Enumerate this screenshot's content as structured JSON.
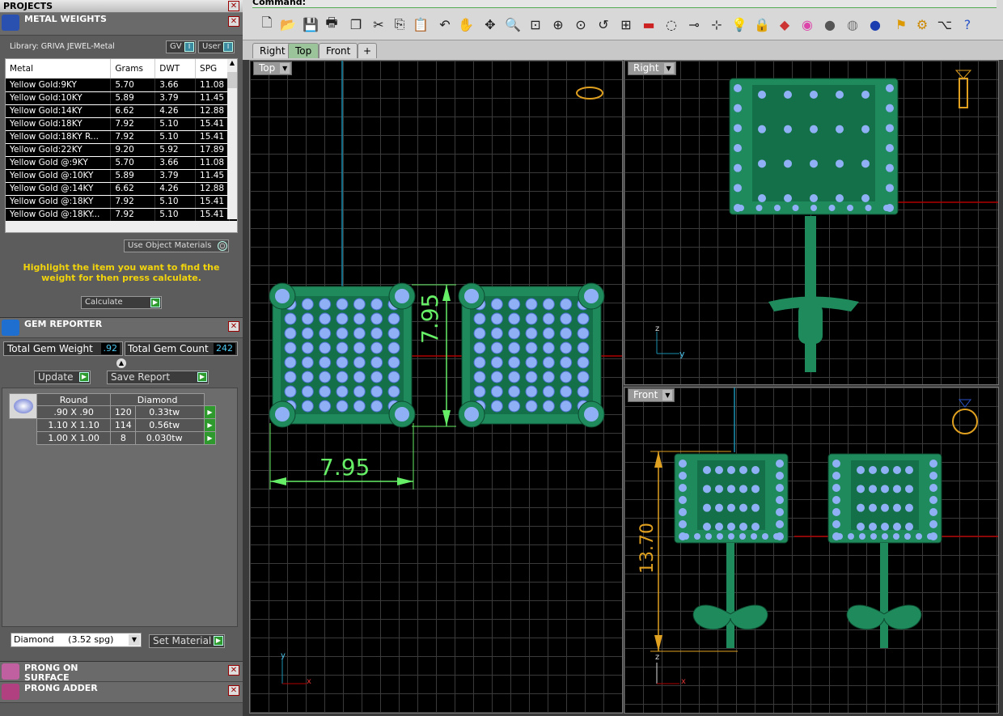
{
  "command_label": "Command:",
  "panels": {
    "projects": {
      "title": "PROJECTS"
    },
    "metal_weights": {
      "title": "METAL WEIGHTS",
      "library": "Library: GRIVA JEWEL-Metal",
      "gv": "GV",
      "user": "User",
      "columns": [
        "Metal",
        "Grams",
        "DWT",
        "SPG"
      ],
      "rows": [
        [
          "Yellow Gold:9KY",
          "5.70",
          "3.66",
          "11.08"
        ],
        [
          "Yellow Gold:10KY",
          "5.89",
          "3.79",
          "11.45"
        ],
        [
          "Yellow Gold:14KY",
          "6.62",
          "4.26",
          "12.88"
        ],
        [
          "Yellow Gold:18KY",
          "7.92",
          "5.10",
          "15.41"
        ],
        [
          "Yellow Gold:18KY R...",
          "7.92",
          "5.10",
          "15.41"
        ],
        [
          "Yellow Gold:22KY",
          "9.20",
          "5.92",
          "17.89"
        ],
        [
          "Yellow Gold @:9KY",
          "5.70",
          "3.66",
          "11.08"
        ],
        [
          "Yellow Gold @:10KY",
          "5.89",
          "3.79",
          "11.45"
        ],
        [
          "Yellow Gold @:14KY",
          "6.62",
          "4.26",
          "12.88"
        ],
        [
          "Yellow Gold @:18KY",
          "7.92",
          "5.10",
          "15.41"
        ],
        [
          "Yellow Gold @:18KY...",
          "7.92",
          "5.10",
          "15.41"
        ]
      ],
      "use_object_materials": "Use Object Materials",
      "hint": "Highlight the item you want to find the weight for then press calculate.",
      "calculate": "Calculate"
    },
    "gem_reporter": {
      "title": "GEM REPORTER",
      "total_weight_label": "Total Gem Weight",
      "total_weight_value": ".92",
      "total_count_label": "Total Gem Count",
      "total_count_value": "242",
      "update": "Update",
      "save_report": "Save Report",
      "col_shape": "Round",
      "col_material": "Diamond",
      "rows": [
        [
          ".90 X .90",
          "120",
          "0.33tw"
        ],
        [
          "1.10 X 1.10",
          "114",
          "0.56tw"
        ],
        [
          "1.00 X 1.00",
          "8",
          "0.030tw"
        ]
      ],
      "material_select": "Diamond     (3.52 spg)",
      "set_material": "Set Material"
    },
    "prong_on_surface": {
      "title": "PRONG ON SURFACE"
    },
    "prong_adder": {
      "title": "PRONG ADDER"
    }
  },
  "viewport_tabs": [
    "Right",
    "Top",
    "Front"
  ],
  "viewports": {
    "top": {
      "label": "Top",
      "dim_h": "7.95",
      "dim_v": "7.95"
    },
    "right": {
      "label": "Right"
    },
    "front": {
      "label": "Front",
      "dim_v": "13.70"
    }
  },
  "axes": {
    "x": "x",
    "y": "y",
    "z": "z"
  },
  "colors": {
    "metal": "#1f8a5c",
    "gem": "#8fb0f5",
    "dimension": "#66ee66",
    "dimension_front": "#e0a020",
    "grid": "#3a3a3a",
    "axis_red": "#b00000",
    "axis_blue": "#1a8fb0"
  }
}
